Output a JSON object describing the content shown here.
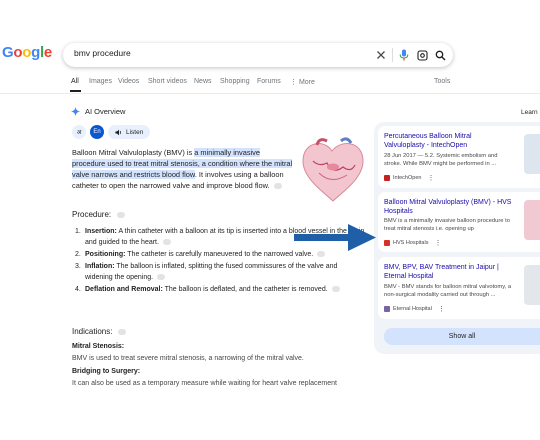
{
  "brand": {
    "logo_letters": [
      "G",
      "o",
      "o",
      "g",
      "l",
      "e"
    ],
    "logo_colors": [
      "#4285f4",
      "#ea4335",
      "#fbbc05",
      "#4285f4",
      "#34a853",
      "#ea4335"
    ]
  },
  "search": {
    "query": "bmv procedure"
  },
  "tabs": [
    {
      "label": "All",
      "active": true
    },
    {
      "label": "Images"
    },
    {
      "label": "Videos"
    },
    {
      "label": "Short videos"
    },
    {
      "label": "News"
    },
    {
      "label": "Shopping"
    },
    {
      "label": "Forums"
    },
    {
      "label": "More"
    },
    {
      "label": "Tools"
    }
  ],
  "overview": {
    "title": "AI Overview",
    "learn_more": "Learn",
    "lang_a": "अ",
    "lang_en": "En",
    "listen": "Listen",
    "summary": {
      "plain_1": "Balloon Mitral Valvuloplasty (BMV) is ",
      "highlight": "a minimally invasive procedure used to treat mitral stenosis, a condition where the mitral valve narrows and restricts blood flow",
      "plain_2": ". It involves using a balloon catheter to open the narrowed valve and improve blood flow."
    },
    "procedure_heading": "Procedure:",
    "steps": [
      {
        "num": "1.",
        "term": "Insertion:",
        "text": " A thin catheter with a balloon at its tip is inserted into a blood vessel in the groin and guided to the heart."
      },
      {
        "num": "2.",
        "term": "Positioning:",
        "text": " The catheter is carefully maneuvered to the narrowed valve."
      },
      {
        "num": "3.",
        "term": "Inflation:",
        "text": " The balloon is inflated, splitting the fused commissures of the valve and widening the opening."
      },
      {
        "num": "4.",
        "term": "Deflation and Removal:",
        "text": " The balloon is deflated, and the catheter is removed."
      }
    ],
    "indications_heading": "Indications:",
    "ind_1_title": "Mitral Stenosis:",
    "ind_1_text": "BMV is used to treat severe mitral stenosis, a narrowing of the mitral valve.",
    "ind_2_title": "Bridging to Surgery:",
    "ind_2_text": "It can also be used as a temporary measure while waiting for heart valve replacement"
  },
  "sources": [
    {
      "title": "Percutaneous Balloon Mitral Valvuloplasty - IntechOpen",
      "snippet": "28 Jun 2017 — 5.2. Systemic embolism and stroke. While BMV might be performed in ...",
      "site": "IntechOpen",
      "fav_color": "#c5221f"
    },
    {
      "title": "Balloon Mitral Valvuloplasty (BMV) - HVS Hospitals",
      "snippet": "BMV is a minimally invasive balloon procedure to treat mitral stenosis i.e. opening up",
      "site": "HVS Hospitals",
      "fav_color": "#d93025"
    },
    {
      "title": "BMV, BPV, BAV Treatment in Jaipur | Eternal Hospital",
      "snippet": "BMV - BMV stands for balloon mitral valvotomy, a non-surgical modality carried out through ...",
      "site": "Eternal Hospital",
      "fav_color": "#7b61a6"
    }
  ],
  "show_all": "Show all",
  "colors": {
    "accent": "#0b57d0",
    "link": "#1a0dab",
    "highlight": "#d3e3fd",
    "arrow": "#1f5fa8"
  }
}
